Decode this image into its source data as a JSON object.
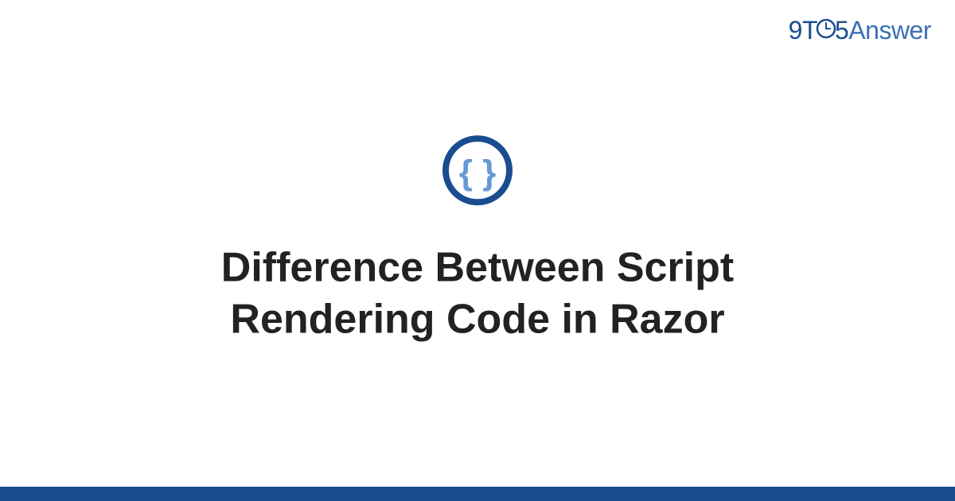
{
  "logo": {
    "text_9": "9",
    "text_t": "T",
    "text_5": "5",
    "text_answer": "Answer"
  },
  "main": {
    "title": "Difference Between Script Rendering Code in Razor"
  },
  "icons": {
    "code_braces": "code-braces-icon",
    "clock": "clock-icon"
  },
  "colors": {
    "primary_dark": "#1a4d8f",
    "primary_light": "#6699d4",
    "text_dark": "#222222"
  }
}
